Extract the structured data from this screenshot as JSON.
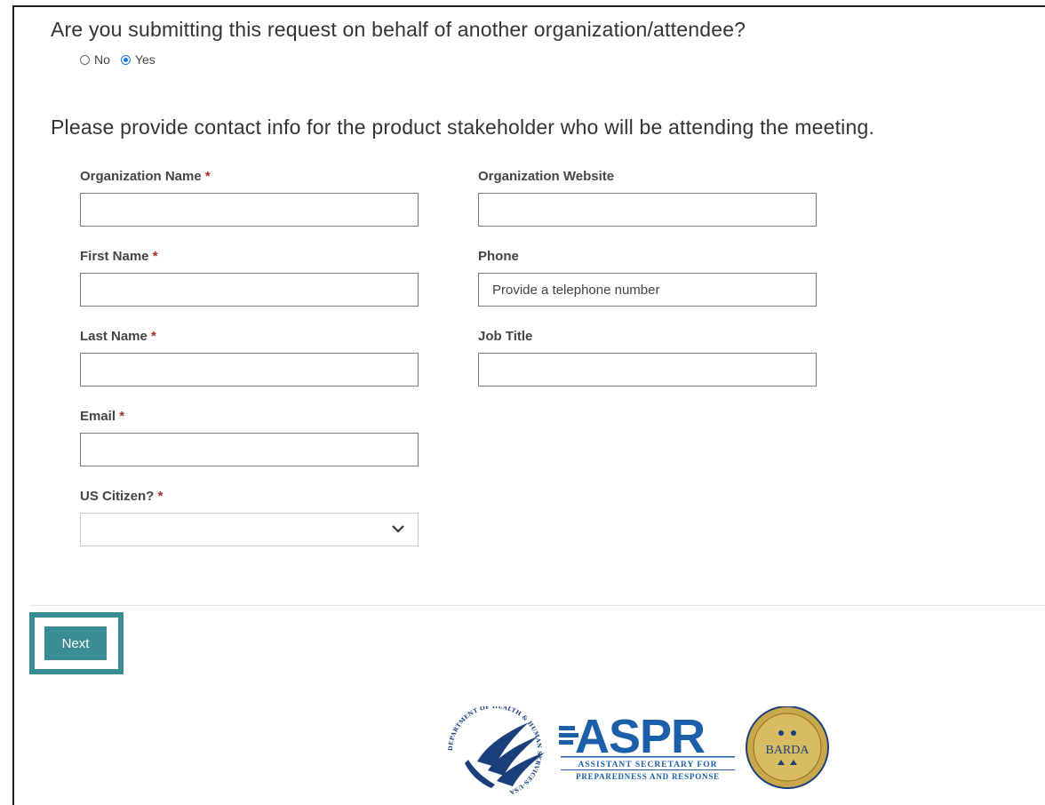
{
  "question": "Are you submitting this request on behalf of another organization/attendee?",
  "radio_options": [
    {
      "label": "No",
      "checked": false
    },
    {
      "label": "Yes",
      "checked": true
    }
  ],
  "intro": "Please provide contact info for the product stakeholder who will be attending the meeting.",
  "fields": {
    "org_name": {
      "label": "Organization Name",
      "required": "*",
      "value": ""
    },
    "org_website": {
      "label": "Organization Website",
      "value": ""
    },
    "first_name": {
      "label": "First Name",
      "required": "*",
      "value": ""
    },
    "phone": {
      "label": "Phone",
      "placeholder": "Provide a telephone number",
      "value": ""
    },
    "last_name": {
      "label": "Last Name",
      "required": "*",
      "value": ""
    },
    "job_title": {
      "label": "Job Title",
      "value": ""
    },
    "email": {
      "label": "Email",
      "required": "*",
      "value": ""
    },
    "us_citizen": {
      "label": "US Citizen?",
      "required": "*",
      "selected": ""
    }
  },
  "next_label": "Next",
  "logos": {
    "hhs_seal_text": "DEPARTMENT OF HEALTH & HUMAN SERVICES·USA",
    "aspr": "ASPR",
    "aspr_line1": "ASSISTANT SECRETARY FOR",
    "aspr_line2": "PREPAREDNESS AND RESPONSE",
    "barda": "BARDA"
  },
  "colors": {
    "accent": "#3a8c95",
    "radio_checked": "#1a73e8",
    "required": "#a52a2a",
    "aspr_blue": "#1b5fa8",
    "barda_gold": "#c9a84c"
  }
}
